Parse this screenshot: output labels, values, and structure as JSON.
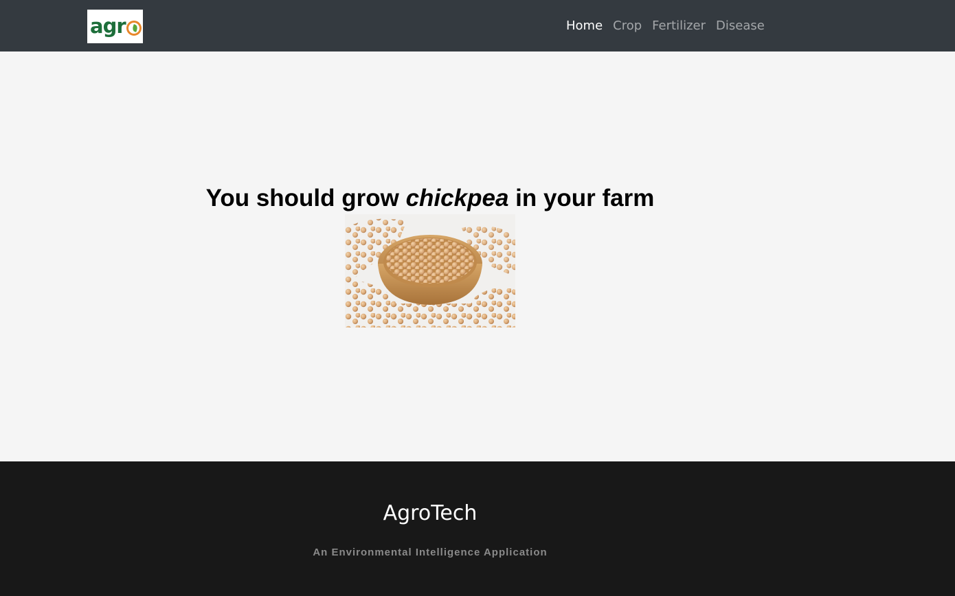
{
  "navbar": {
    "logo_text": "agr",
    "links": [
      {
        "label": "Home",
        "active": true
      },
      {
        "label": "Crop",
        "active": false
      },
      {
        "label": "Fertilizer",
        "active": false
      },
      {
        "label": "Disease",
        "active": false
      }
    ]
  },
  "main": {
    "heading_prefix": "You should grow ",
    "crop_name": "chickpea",
    "heading_suffix": " in your farm",
    "image_subject": "chickpeas-in-wooden-bowl"
  },
  "footer": {
    "title": "AgroTech",
    "subtitle": "An Environmental Intelligence Application"
  },
  "colors": {
    "navbar_bg": "#343a40",
    "main_bg": "#f5f5f5",
    "footer_bg": "#181818",
    "logo_green": "#1d6e3a",
    "logo_orange": "#e8872a"
  }
}
